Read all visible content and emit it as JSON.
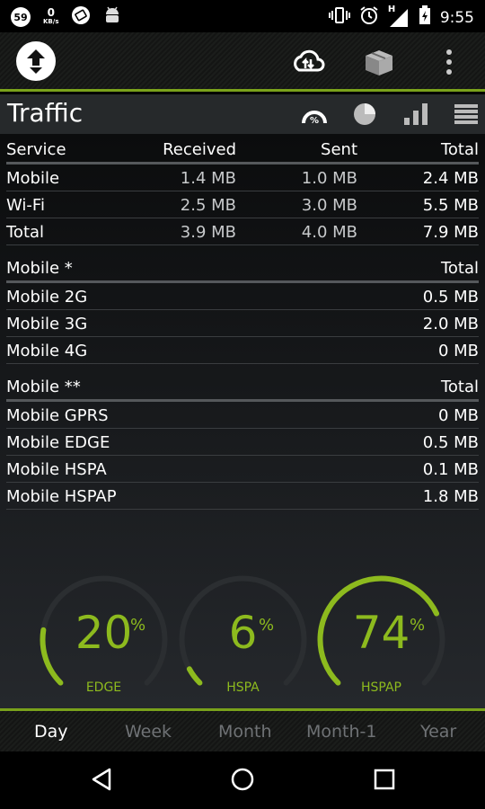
{
  "status_bar": {
    "badge_count": "59",
    "speed_value": "0",
    "speed_unit": "KB/s",
    "network_type": "H",
    "time": "9:55",
    "icons": [
      "screenshot-icon",
      "android-icon",
      "vibrate-icon",
      "alarm-icon",
      "signal-icon",
      "battery-charging-icon"
    ]
  },
  "app_bar": {
    "icons": [
      "app-logo-icon",
      "cloud-sync-icon",
      "packages-icon",
      "overflow-menu-icon"
    ]
  },
  "title_bar": {
    "title": "Traffic",
    "icons": [
      "gauge-percent-icon",
      "pie-chart-icon",
      "signal-bars-icon",
      "list-icon"
    ]
  },
  "traffic_table": {
    "headers": [
      "Service",
      "Received",
      "Sent",
      "Total"
    ],
    "rows": [
      {
        "service": "Mobile",
        "received": "1.4 MB",
        "sent": "1.0 MB",
        "total": "2.4 MB"
      },
      {
        "service": "Wi-Fi",
        "received": "2.5 MB",
        "sent": "3.0 MB",
        "total": "5.5 MB"
      },
      {
        "service": "Total",
        "received": "3.9 MB",
        "sent": "4.0 MB",
        "total": "7.9 MB"
      }
    ]
  },
  "mobile_gen_table": {
    "headers": [
      "Mobile *",
      "Total"
    ],
    "rows": [
      {
        "name": "Mobile 2G",
        "total": "0.5 MB"
      },
      {
        "name": "Mobile 3G",
        "total": "2.0 MB"
      },
      {
        "name": "Mobile 4G",
        "total": "0 MB"
      }
    ]
  },
  "mobile_tech_table": {
    "headers": [
      "Mobile **",
      "Total"
    ],
    "rows": [
      {
        "name": "Mobile GPRS",
        "total": "0 MB"
      },
      {
        "name": "Mobile EDGE",
        "total": "0.5 MB"
      },
      {
        "name": "Mobile HSPA",
        "total": "0.1 MB"
      },
      {
        "name": "Mobile HSPAP",
        "total": "1.8 MB"
      }
    ]
  },
  "gauges": [
    {
      "value": "20",
      "percent": 20,
      "unit": "%",
      "label": "EDGE"
    },
    {
      "value": "6",
      "percent": 6,
      "unit": "%",
      "label": "HSPA"
    },
    {
      "value": "74",
      "percent": 74,
      "unit": "%",
      "label": "HSPAP"
    }
  ],
  "colors": {
    "accent": "#8dba1e",
    "track": "#2b2e31"
  },
  "tabs": [
    {
      "label": "Day",
      "active": true
    },
    {
      "label": "Week",
      "active": false
    },
    {
      "label": "Month",
      "active": false
    },
    {
      "label": "Month-1",
      "active": false
    },
    {
      "label": "Year",
      "active": false
    }
  ],
  "nav_bar": {
    "icons": [
      "back-icon",
      "home-icon",
      "recents-icon"
    ]
  }
}
